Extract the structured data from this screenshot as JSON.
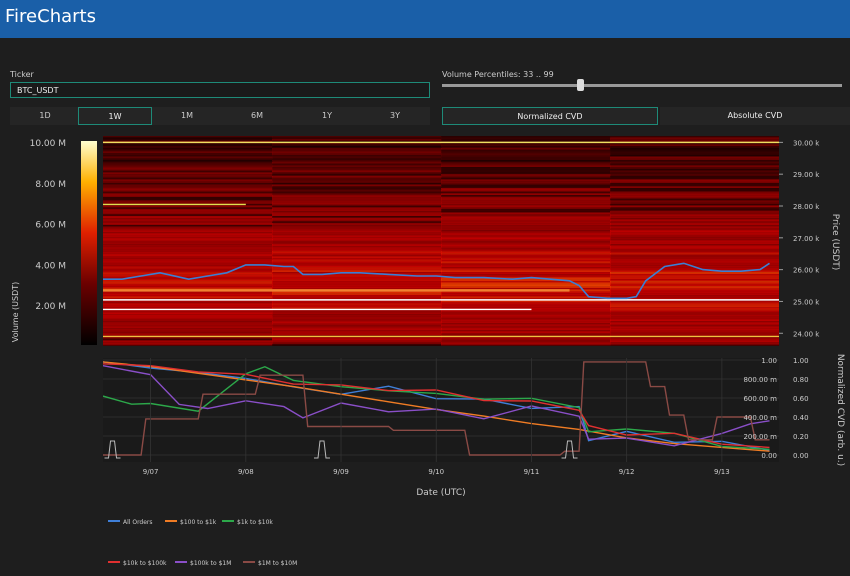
{
  "app": {
    "title": "FireCharts"
  },
  "ticker": {
    "label": "Ticker",
    "value": "BTC_USDT"
  },
  "timeframes": [
    "1D",
    "1W",
    "1M",
    "6M",
    "1Y",
    "3Y"
  ],
  "active_timeframe": "1W",
  "volume_percentiles": {
    "label": "Volume Percentiles: 33 .. 99",
    "low": 33,
    "high": 99
  },
  "cvd_modes": {
    "normalized": "Normalized CVD",
    "absolute": "Absolute CVD",
    "active": "Normalized CVD"
  },
  "chart_data": [
    {
      "type": "heatmap",
      "title": "",
      "colorbar": {
        "label": "Volume (USDT)",
        "ticks": [
          "2.00 M",
          "4.00 M",
          "6.00 M",
          "8.00 M",
          "10.00 M"
        ],
        "range": [
          0,
          10000000
        ]
      },
      "y_axis": {
        "label": "Price (USDT)",
        "ticks": [
          "24.00 k",
          "25.00 k",
          "26.00 k",
          "27.00 k",
          "28.00 k",
          "29.00 k",
          "30.00 k"
        ],
        "range": [
          23600,
          30200
        ]
      },
      "price_series": {
        "name": "",
        "color": "#3a7fd5",
        "x_day": [
          6.5,
          6.7,
          6.9,
          7.1,
          7.4,
          7.6,
          7.8,
          8.0,
          8.2,
          8.4,
          8.5,
          8.6,
          8.8,
          9.0,
          9.2,
          9.5,
          9.8,
          10.0,
          10.2,
          10.5,
          10.8,
          11.0,
          11.2,
          11.4,
          11.5,
          11.6,
          11.8,
          12.0,
          12.1,
          12.2,
          12.4,
          12.6,
          12.8,
          13.0,
          13.2,
          13.4,
          13.5
        ],
        "y": [
          25700,
          25700,
          25800,
          25900,
          25700,
          25800,
          25900,
          26150,
          26150,
          26100,
          26100,
          25850,
          25850,
          25900,
          25900,
          25850,
          25800,
          25800,
          25750,
          25750,
          25700,
          25750,
          25700,
          25650,
          25500,
          25150,
          25100,
          25100,
          25150,
          25650,
          26100,
          26200,
          26000,
          25950,
          25950,
          26000,
          26200
        ]
      },
      "bright_levels": [
        30000,
        28050,
        25050,
        24750,
        23900
      ]
    },
    {
      "type": "line",
      "y_axis": {
        "label": "Normalized CVD (arb. u.)",
        "ticks": [
          "0.00",
          "0.20",
          "0.40",
          "0.60",
          "0.80",
          "1.00"
        ],
        "range": [
          0,
          1
        ]
      },
      "y_axis_left": {
        "ticks": [
          "0.00",
          "200.00 m",
          "400.00 m",
          "600.00 m",
          "800.00 m",
          "1.00"
        ]
      },
      "x_axis": {
        "label": "Date (UTC)",
        "ticks": [
          "9/07",
          "9/08",
          "9/09",
          "9/10",
          "9/11",
          "9/12",
          "9/13"
        ],
        "range": [
          6.5,
          13.6
        ]
      },
      "series": [
        {
          "name": "All Orders",
          "color": "#3f7fd8",
          "x": [
            6.5,
            7.0,
            7.5,
            8.0,
            8.5,
            9.0,
            9.5,
            10.0,
            10.5,
            11.0,
            11.5,
            11.6,
            12.0,
            12.5,
            13.0,
            13.5
          ],
          "y": [
            0.98,
            0.92,
            0.86,
            0.82,
            0.7,
            0.66,
            0.7,
            0.62,
            0.56,
            0.52,
            0.48,
            0.18,
            0.22,
            0.16,
            0.12,
            0.05
          ]
        },
        {
          "name": "$100 to $1k",
          "color": "#f07c24",
          "x": [
            6.5,
            7.0,
            7.5,
            8.0,
            8.5,
            9.0,
            9.5,
            10.0,
            10.5,
            11.0,
            11.5,
            12.0,
            12.5,
            13.0,
            13.5
          ],
          "y": [
            0.98,
            0.93,
            0.86,
            0.79,
            0.72,
            0.64,
            0.56,
            0.48,
            0.41,
            0.33,
            0.27,
            0.18,
            0.12,
            0.08,
            0.04
          ]
        },
        {
          "name": "$1k to $10k",
          "color": "#2ca84a",
          "x": [
            6.5,
            6.8,
            7.0,
            7.5,
            8.0,
            8.2,
            8.5,
            9.0,
            9.5,
            10.0,
            10.5,
            11.0,
            11.5,
            11.6,
            12.0,
            12.5,
            13.0,
            13.5
          ],
          "y": [
            0.62,
            0.56,
            0.52,
            0.48,
            0.84,
            0.94,
            0.78,
            0.72,
            0.68,
            0.64,
            0.6,
            0.58,
            0.52,
            0.22,
            0.3,
            0.2,
            0.12,
            0.06
          ]
        },
        {
          "name": "$10k to $100k",
          "color": "#e03030",
          "x": [
            6.5,
            7.0,
            7.5,
            8.0,
            8.5,
            9.0,
            9.5,
            10.0,
            10.5,
            11.0,
            11.5,
            11.6,
            12.0,
            12.5,
            13.0,
            13.5
          ],
          "y": [
            0.96,
            0.94,
            0.88,
            0.84,
            0.76,
            0.72,
            0.7,
            0.66,
            0.6,
            0.54,
            0.5,
            0.28,
            0.24,
            0.2,
            0.14,
            0.08
          ]
        },
        {
          "name": "$100k to $1M",
          "color": "#8a4fc8",
          "x": [
            6.5,
            7.0,
            7.3,
            7.6,
            8.0,
            8.4,
            8.6,
            9.0,
            9.5,
            10.0,
            10.5,
            11.0,
            11.5,
            11.6,
            12.0,
            12.5,
            13.0,
            13.3,
            13.5
          ],
          "y": [
            0.94,
            0.82,
            0.56,
            0.46,
            0.6,
            0.48,
            0.42,
            0.52,
            0.48,
            0.46,
            0.4,
            0.5,
            0.42,
            0.16,
            0.18,
            0.1,
            0.22,
            0.34,
            0.36
          ]
        },
        {
          "name": "$1M to $10M",
          "color": "#8a4a45",
          "x": [
            6.5,
            6.9,
            6.95,
            7.5,
            7.55,
            8.1,
            8.15,
            8.6,
            8.65,
            9.5,
            9.55,
            10.3,
            10.35,
            11.3,
            11.35,
            11.5,
            11.55,
            12.2,
            12.25,
            12.4,
            12.45,
            12.6,
            12.65,
            12.9,
            12.95,
            13.3,
            13.35,
            13.5
          ],
          "y": [
            0.0,
            0.0,
            0.38,
            0.38,
            0.64,
            0.64,
            0.84,
            0.84,
            0.3,
            0.3,
            0.26,
            0.26,
            0.0,
            0.0,
            0.04,
            0.04,
            0.98,
            0.98,
            0.72,
            0.72,
            0.42,
            0.42,
            0.16,
            0.16,
            0.4,
            0.4,
            0.16,
            0.16
          ]
        }
      ]
    }
  ]
}
